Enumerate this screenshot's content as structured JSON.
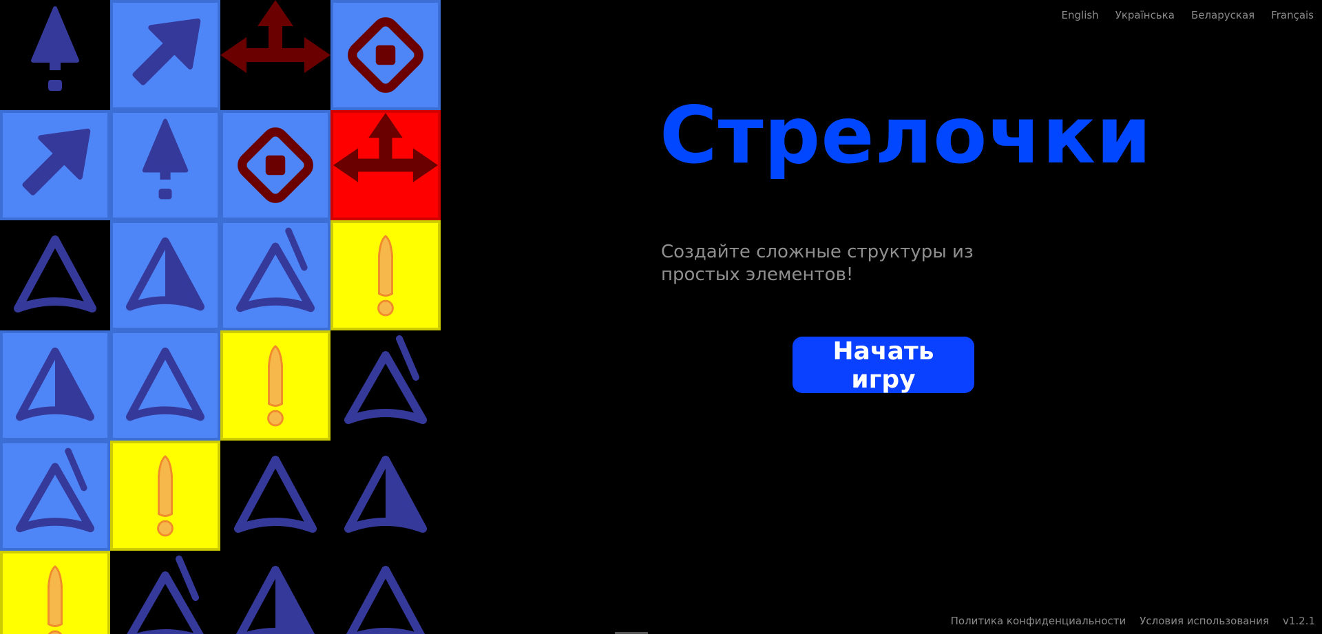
{
  "languages": [
    "English",
    "Українська",
    "Беларуская",
    "Français"
  ],
  "game": {
    "title": "Стрелочки",
    "subtitle": "Создайте сложные структуры из простых элементов!",
    "start_button": "Начать игру"
  },
  "footer": {
    "privacy": "Политика конфиденциальности",
    "terms": "Условия использования",
    "version": "v1.2.1"
  },
  "colors": {
    "background": "#000000",
    "accent": "#0047ff",
    "button": "#0a40ff",
    "tile_blue": "#4f86f7",
    "tile_red": "#ff0000",
    "tile_yellow": "#ffff00",
    "arrow_blue": "#35399a",
    "arrow_dark_red": "#6a0000",
    "arrow_orange": "#f6b84a"
  },
  "board": {
    "columns": 4,
    "rows": [
      [
        {
          "bg": "empty",
          "icon": "up-arrow-icon"
        },
        {
          "bg": "blue",
          "icon": "diagonal-arrow-icon"
        },
        {
          "bg": "empty",
          "icon": "three-way-arrow-icon"
        },
        {
          "bg": "blue",
          "icon": "diamond-stop-icon"
        }
      ],
      [
        {
          "bg": "blue",
          "icon": "diagonal-arrow-icon"
        },
        {
          "bg": "blue",
          "icon": "up-arrow-icon"
        },
        {
          "bg": "blue",
          "icon": "diamond-stop-icon"
        },
        {
          "bg": "red",
          "icon": "three-way-arrow-icon"
        }
      ],
      [
        {
          "bg": "empty",
          "icon": "outline-triangle-icon"
        },
        {
          "bg": "blue",
          "icon": "half-filled-triangle-icon"
        },
        {
          "bg": "blue",
          "icon": "slashed-triangle-icon"
        },
        {
          "bg": "yellow",
          "icon": "exclamation-icon"
        }
      ],
      [
        {
          "bg": "blue",
          "icon": "half-filled-triangle-icon"
        },
        {
          "bg": "blue",
          "icon": "outline-triangle-icon"
        },
        {
          "bg": "yellow",
          "icon": "exclamation-icon"
        },
        {
          "bg": "empty",
          "icon": "slashed-triangle-icon"
        }
      ],
      [
        {
          "bg": "blue",
          "icon": "slashed-triangle-icon"
        },
        {
          "bg": "yellow",
          "icon": "exclamation-icon"
        },
        {
          "bg": "empty",
          "icon": "outline-triangle-icon"
        },
        {
          "bg": "empty",
          "icon": "half-filled-triangle-icon"
        }
      ],
      [
        {
          "bg": "yellow",
          "icon": "exclamation-icon"
        },
        {
          "bg": "empty",
          "icon": "slashed-triangle-icon"
        },
        {
          "bg": "empty",
          "icon": "half-filled-triangle-icon"
        },
        {
          "bg": "empty",
          "icon": "outline-triangle-icon"
        }
      ]
    ]
  }
}
